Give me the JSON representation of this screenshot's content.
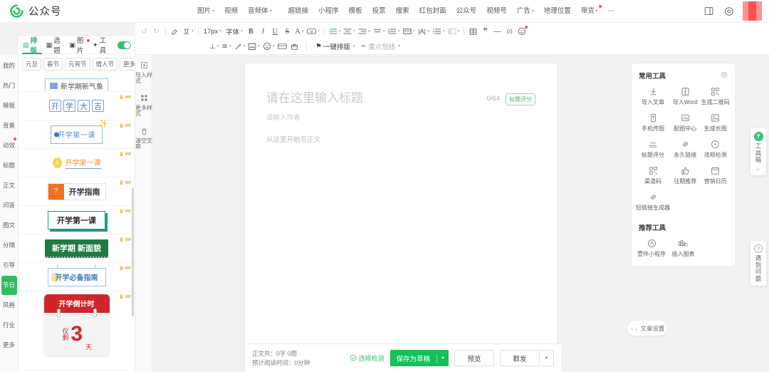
{
  "topbar": {
    "brand": "公众号",
    "nav_left": [
      {
        "label": "图片",
        "caret": true,
        "dot": false
      },
      {
        "label": "视频",
        "caret": false,
        "dot": false
      },
      {
        "label": "音频体",
        "caret": true,
        "dot": false
      }
    ],
    "nav_right": [
      {
        "label": "超链接",
        "caret": false,
        "dot": false
      },
      {
        "label": "小程序",
        "caret": false,
        "dot": false
      },
      {
        "label": "模板",
        "caret": false,
        "dot": false
      },
      {
        "label": "投票",
        "caret": false,
        "dot": false
      },
      {
        "label": "搜索",
        "caret": false,
        "dot": false
      },
      {
        "label": "红包封面",
        "caret": false,
        "dot": false
      },
      {
        "label": "公众号",
        "caret": false,
        "dot": false
      },
      {
        "label": "视频号",
        "caret": false,
        "dot": false
      },
      {
        "label": "广告",
        "caret": true,
        "dot": false
      },
      {
        "label": "地理位置",
        "caret": false,
        "dot": false
      },
      {
        "label": "带货",
        "caret": true,
        "dot": true
      },
      {
        "label": "⋯",
        "caret": false,
        "dot": false
      }
    ],
    "icons": {
      "layout": "layout-panel-icon",
      "settings": "gear-icon",
      "avatar": "avatar"
    }
  },
  "toolbar": {
    "row1": [
      {
        "name": "undo-button",
        "glyph": "↺",
        "caret": false,
        "disabled": true
      },
      {
        "name": "redo-button",
        "glyph": "↻",
        "caret": false,
        "disabled": true
      },
      {
        "sep": true
      },
      {
        "name": "format-painter-button",
        "glyph": "✎",
        "caret": false
      },
      {
        "name": "clear-format-button",
        "glyph": "⌫",
        "caret": true
      },
      {
        "sep": true
      },
      {
        "name": "font-size-select",
        "text": "17px",
        "caret": true
      },
      {
        "name": "font-family-select",
        "text": "字体",
        "caret": true
      },
      {
        "name": "bold-button",
        "glyph": "B",
        "caret": false
      },
      {
        "name": "italic-button",
        "glyph": "I",
        "caret": false
      },
      {
        "name": "underline-button",
        "glyph": "U",
        "caret": false
      },
      {
        "name": "strikethrough-button",
        "glyph": "S",
        "caret": false
      },
      {
        "name": "font-color-button",
        "glyph": "A",
        "caret": true
      },
      {
        "name": "highlight-color-button",
        "glyph": "▭",
        "caret": true
      },
      {
        "sep": true
      },
      {
        "name": "align-left-button",
        "glyph": "▤",
        "caret": true,
        "green": true
      },
      {
        "name": "align-center-button",
        "glyph": "▤",
        "caret": true
      },
      {
        "name": "align-right-button",
        "glyph": "▤",
        "caret": true
      },
      {
        "name": "align-justify-button",
        "glyph": "≡",
        "caret": true
      },
      {
        "name": "line-height-button",
        "glyph": "↕",
        "caret": true
      },
      {
        "name": "indent-button",
        "glyph": "▦",
        "caret": true
      },
      {
        "name": "letter-spacing-button",
        "glyph": "|A|",
        "caret": true
      },
      {
        "name": "list-button",
        "glyph": "☰",
        "caret": true
      },
      {
        "name": "margin-button",
        "glyph": "▯",
        "caret": true,
        "disabled": true
      },
      {
        "sep": true
      },
      {
        "name": "table-button",
        "glyph": "▦",
        "caret": false
      },
      {
        "name": "quote-button",
        "glyph": "❞",
        "caret": false
      },
      {
        "name": "divider-button",
        "glyph": "—",
        "caret": false
      },
      {
        "name": "code-button",
        "glyph": "⟨/⟩",
        "caret": false
      },
      {
        "name": "emoji-button",
        "glyph": "☺",
        "caret": false,
        "dot": true
      }
    ],
    "row2": [
      {
        "name": "text-style-button",
        "glyph": "⊥",
        "caret": true
      },
      {
        "name": "text-effect-button",
        "glyph": "≋",
        "caret": true
      },
      {
        "name": "magic-wand-button",
        "glyph": "✨",
        "caret": true
      },
      {
        "name": "image-frame-button",
        "glyph": "▣",
        "caret": true
      },
      {
        "name": "sticker-button",
        "glyph": "☻",
        "caret": true
      },
      {
        "name": "card-button",
        "glyph": "▤",
        "caret": false
      },
      {
        "name": "gift-button",
        "glyph": "🗃",
        "caret": false
      }
    ],
    "autoformat_label": "一键排版",
    "highlight_label": "重点划线"
  },
  "left_rail": [
    {
      "label": "我的",
      "active": false,
      "dot": false
    },
    {
      "label": "热门",
      "active": false,
      "dot": false
    },
    {
      "label": "模板",
      "active": false,
      "dot": false
    },
    {
      "label": "背景",
      "active": false,
      "dot": false
    },
    {
      "label": "动效",
      "active": false,
      "dot": true
    },
    {
      "label": "标题",
      "active": false,
      "dot": false
    },
    {
      "label": "正文",
      "active": false,
      "dot": false
    },
    {
      "label": "问答",
      "active": false,
      "dot": false
    },
    {
      "label": "图文",
      "active": false,
      "dot": false
    },
    {
      "label": "分隔",
      "active": false,
      "dot": false
    },
    {
      "label": "引导",
      "active": false,
      "dot": false
    },
    {
      "label": "节日",
      "active": true,
      "dot": false
    },
    {
      "label": "风格",
      "active": false,
      "dot": false
    },
    {
      "label": "行业",
      "active": false,
      "dot": false
    },
    {
      "label": "更多",
      "active": false,
      "dot": false
    }
  ],
  "left_panel": {
    "tabs": [
      {
        "label": "排版",
        "icon": "layout-icon",
        "active": true
      },
      {
        "label": "选题",
        "icon": "book-icon",
        "active": false
      },
      {
        "label": "图片",
        "icon": "image-icon",
        "active": false
      },
      {
        "label": "工具",
        "icon": "tools-icon",
        "active": false
      }
    ],
    "toggle_on": true,
    "filters": [
      "元旦",
      "春节",
      "元宵节",
      "情人节"
    ],
    "more_label": "更多",
    "search_icon": "search-icon",
    "templates": [
      {
        "name": "tpl-partial-top",
        "kind": "partial",
        "text": "新学期新气象",
        "vip": false
      },
      {
        "name": "tpl-kaixue-daji",
        "kind": "boxes",
        "chars": [
          "开",
          "学",
          "大",
          "吉"
        ],
        "vip": true
      },
      {
        "name": "tpl-kaixue-diyike-bullet",
        "kind": "bullet",
        "text": "开学第一课",
        "vip": true
      },
      {
        "name": "tpl-kaixue-diyike-hex",
        "kind": "hex",
        "badge": "A",
        "text": "开学第一课",
        "vip": true
      },
      {
        "name": "tpl-kaixue-zhinan",
        "kind": "orange",
        "badge": "?",
        "text": "开学指南",
        "vip": true
      },
      {
        "name": "tpl-kaixue-diyike-card",
        "kind": "whitecard",
        "text": "开学第一课",
        "vip": true
      },
      {
        "name": "tpl-xinxueqi",
        "kind": "greenbar",
        "text": "新学期 新面貌",
        "vip": true
      },
      {
        "name": "tpl-kaixue-bikan",
        "kind": "blueline",
        "text": "开学必备指南",
        "vip": true
      },
      {
        "name": "tpl-countdown",
        "kind": "calendar",
        "header": "开学倒计时",
        "small": "仅剩",
        "number": "3",
        "unit": "天",
        "vip": true
      }
    ],
    "actions": [
      {
        "label": "导入样式",
        "icon": "import-style-icon"
      },
      {
        "label": "更多样式",
        "icon": "more-styles-icon"
      },
      {
        "label": "清空文章",
        "icon": "trash-icon"
      }
    ]
  },
  "editor": {
    "title_placeholder": "请在这里输入标题",
    "char_count": "0/64",
    "score_label": "标题评分",
    "author_placeholder": "请输入作者",
    "body_placeholder": "从这里开始写正文"
  },
  "bottombar": {
    "stat_line1": "正文共：0字 0图",
    "stat_line2": "预计阅读时间：0分钟",
    "check_label": "违规检测",
    "save_label": "保存为草稿",
    "preview_label": "预览",
    "send_label": "群发"
  },
  "tools_panel": {
    "title": "常用工具",
    "gear_icon": "gear-icon",
    "common": [
      {
        "label": "导入文章",
        "icon": "download-icon"
      },
      {
        "label": "导入Word",
        "icon": "word-icon"
      },
      {
        "label": "生成二维码",
        "icon": "qrcode-icon"
      },
      {
        "label": "手机传图",
        "icon": "phone-upload-icon"
      },
      {
        "label": "配图中心",
        "icon": "picture-center-icon"
      },
      {
        "label": "生成长图",
        "icon": "long-image-icon"
      },
      {
        "label": "标题评分",
        "icon": "title-score-icon"
      },
      {
        "label": "永久链接",
        "icon": "link-icon"
      },
      {
        "label": "违规检测",
        "icon": "shield-check-icon"
      },
      {
        "label": "渠道码",
        "icon": "channel-qr-icon"
      },
      {
        "label": "往期推荐",
        "icon": "thumbs-up-icon"
      },
      {
        "label": "营销日历",
        "icon": "calendar-icon"
      },
      {
        "label": "短链接生成器",
        "icon": "short-link-icon"
      }
    ],
    "sub_title": "推荐工具",
    "recommended": [
      {
        "label": "壹伴小程序",
        "icon": "miniprogram-icon"
      },
      {
        "label": "插入图表",
        "icon": "chart-icon"
      }
    ],
    "article_settings_label": "文章设置"
  },
  "dock": {
    "toolbox_label": "工具箱",
    "toolbox_logo": "Y",
    "toolbox_arrow": "←",
    "help_label": "遇到问题",
    "help_icon": "question-icon"
  },
  "colors": {
    "brand_green": "#22b573",
    "accent_green": "#14c05a",
    "red": "#fa5151",
    "vip_gold": "#f0a30a"
  }
}
